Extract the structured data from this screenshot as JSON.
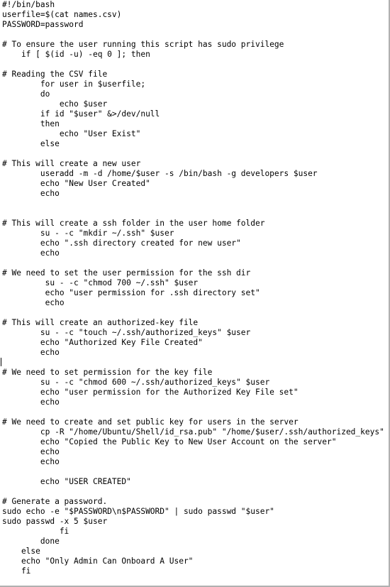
{
  "editor": {
    "lines": [
      "#!/bin/bash",
      "userfile=$(cat names.csv)",
      "PASSWORD=password",
      "",
      "# To ensure the user running this script has sudo privilege",
      "    if [ $(id -u) -eq 0 ]; then",
      "",
      "# Reading the CSV file",
      "        for user in $userfile;",
      "        do",
      "            echo $user",
      "        if id \"$user\" &>/dev/null",
      "        then",
      "            echo \"User Exist\"",
      "        else",
      "",
      "# This will create a new user",
      "        useradd -m -d /home/$user -s /bin/bash -g developers $user",
      "        echo \"New User Created\"",
      "        echo",
      "",
      "",
      "# This will create a ssh folder in the user home folder",
      "        su - -c \"mkdir ~/.ssh\" $user",
      "        echo \".ssh directory created for new user\"",
      "        echo",
      "",
      "# We need to set the user permission for the ssh dir",
      "         su - -c \"chmod 700 ~/.ssh\" $user",
      "         echo \"user permission for .ssh directory set\"",
      "         echo",
      "",
      "# This will create an authorized-key file",
      "        su - -c \"touch ~/.ssh/authorized_keys\" $user",
      "        echo \"Authorized Key File Created\"",
      "        echo",
      "",
      "# We need to set permission for the key file",
      "        su - -c \"chmod 600 ~/.ssh/authorized_keys\" $user",
      "        echo \"user permission for the Authorized Key File set\"",
      "        echo",
      "",
      "# We need to create and set public key for users in the server",
      "        cp -R \"/home/Ubuntu/Shell/id_rsa.pub\" \"/home/$user/.ssh/authorized_keys\" $user",
      "        echo \"Copied the Public Key to New User Account on the server\"",
      "        echo",
      "        echo",
      "",
      "        echo \"USER CREATED\"",
      "",
      "# Generate a password.",
      "sudo echo -e \"$PASSWORD\\n$PASSWORD\" | sudo passwd \"$user\"",
      "sudo passwd -x 5 $user",
      "            fi",
      "        done",
      "    else",
      "    echo \"Only Admin Can Onboard A User\"",
      "    fi"
    ]
  }
}
